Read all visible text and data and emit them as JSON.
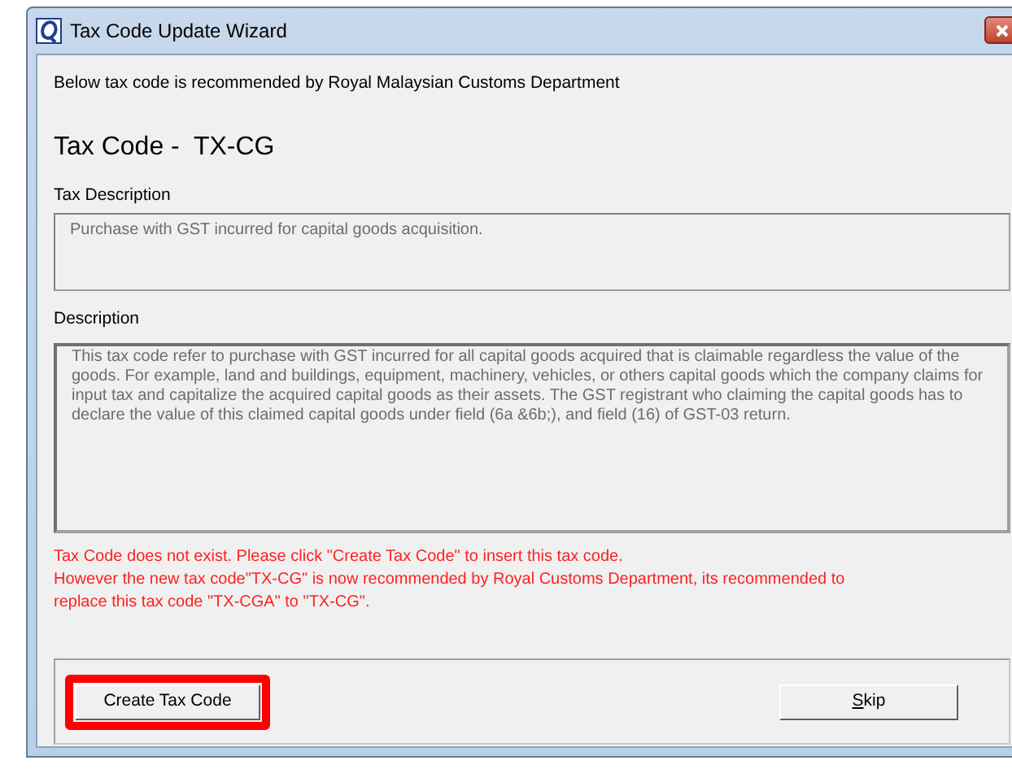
{
  "window": {
    "title": "Tax Code Update Wizard"
  },
  "intro": "Below tax code is recommended by Royal Malaysian Customs Department",
  "heading": {
    "label": "Tax Code - ",
    "code": "TX-CG"
  },
  "tax_description": {
    "label": "Tax Description",
    "value": "Purchase with GST incurred for capital goods acquisition."
  },
  "description": {
    "label": "Description",
    "value": "This tax code refer to purchase with GST incurred for all capital goods acquired that is claimable regardless the value of the goods. For example, land and buildings, equipment, machinery, vehicles, or others capital goods which the company claims for input tax and capitalize the acquired capital goods as their assets. The GST registrant who claiming the capital goods has to declare the value of this claimed capital goods under field (6a &6b;), and field (16) of GST-03 return."
  },
  "warnings": [
    "Tax Code does not exist. Please click \"Create Tax Code\" to insert this tax code.",
    "However the new tax code\"TX-CG\" is now recommended by Royal Customs Department, its recommended to replace this tax code \"TX-CGA\" to \"TX-CG\"."
  ],
  "buttons": [
    {
      "label": "Create Tax Code",
      "highlighted": true
    },
    {
      "label": "Skip",
      "highlighted": false
    }
  ]
}
